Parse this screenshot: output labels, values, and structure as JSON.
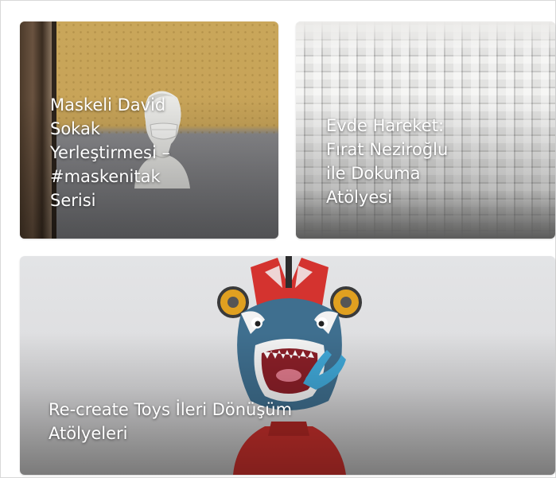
{
  "cards": [
    {
      "title_lines": [
        "Maskeli David",
        "Sokak",
        "Yerleştirmesi –",
        "#maskenitak",
        "Serisi"
      ]
    },
    {
      "title_lines": [
        "Evde Hareket:",
        "Fırat Neziroğlu",
        "ile Dokuma",
        "Atölyesi"
      ]
    },
    {
      "title_lines": [
        "Re-create Toys İleri Dönüşüm",
        "Atölyeleri"
      ]
    }
  ],
  "colors": {
    "wall_yellow": "#c9a65a",
    "wall_gray": "#7b7c80",
    "toy_red": "#d4332f",
    "shark_blue": "#3f6f8f",
    "title_text": "#ffffff"
  },
  "icons": {
    "card1_image": "masked-david-bust-image",
    "card2_image": "woven-texture-image",
    "card3_image": "shark-toy-image"
  }
}
